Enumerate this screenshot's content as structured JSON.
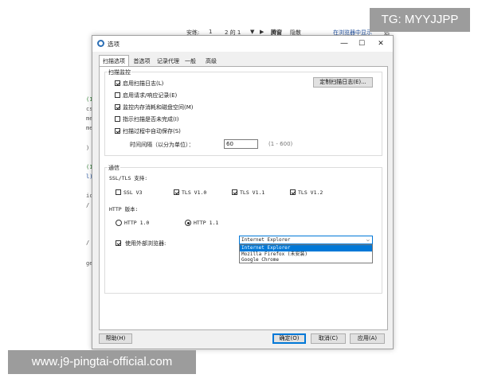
{
  "background": {
    "top_bar": [
      "安练:",
      "1",
      "2 的 1",
      "▼",
      "▶",
      "腾窗",
      "隐散",
      "在浏览器中显示",
      "选"
    ],
    "fragments": [
      "(1",
      "css",
      "me",
      "me",
      ")",
      "(1",
      "l)",
      "ic",
      "/ (",
      "/ (",
      "ge"
    ]
  },
  "watermarks": {
    "top": "TG: MYYJJPP",
    "bottom": "www.j9-pingtai-official.com"
  },
  "dialog": {
    "title": "选项",
    "controls": {
      "minimize": "—",
      "maximize": "☐",
      "close": "✕"
    },
    "tabs": [
      "扫描选项",
      "首选项",
      "记录代理",
      "一般",
      "高级"
    ],
    "scan_monitor": {
      "title": "扫描监控",
      "options": [
        {
          "label": "启用扫描日志(L)",
          "checked": true
        },
        {
          "label": "启用请求/响应记录(E)",
          "checked": false
        },
        {
          "label": "监控内存消耗和磁盘空间(M)",
          "checked": true
        },
        {
          "label": "指示扫描是否未完成(I)",
          "checked": false
        },
        {
          "label": "扫描过程中自动保存(S)",
          "checked": true
        }
      ],
      "custom_log_button": "定制扫描日志(E)...",
      "interval_label": "时间间隔（以分为单位）：",
      "interval_value": "60",
      "interval_range": "(1 - 600)"
    },
    "comm": {
      "title": "通信",
      "ssl_label": "SSL/TLS 支持:",
      "ssl_options": [
        {
          "label": "SSL V3",
          "checked": false
        },
        {
          "label": "TLS V1.0",
          "checked": true
        },
        {
          "label": "TLS V1.1",
          "checked": true
        },
        {
          "label": "TLS V1.2",
          "checked": true
        }
      ],
      "http_label": "HTTP 版本:",
      "http_options": [
        {
          "label": "HTTP 1.0",
          "checked": false
        },
        {
          "label": "HTTP 1.1",
          "checked": true
        }
      ],
      "external_browser_label": "使用外部浏览器:",
      "external_browser_checked": true,
      "browser_selected": "Internet Explorer",
      "browser_options": [
        "Internet Explorer",
        "Mozilla Firefox (未安装)",
        "Google Chrome"
      ]
    },
    "buttons": {
      "help": "帮助(H)",
      "ok": "确定(O)",
      "cancel": "取消(C)",
      "apply": "应用(A)"
    }
  }
}
